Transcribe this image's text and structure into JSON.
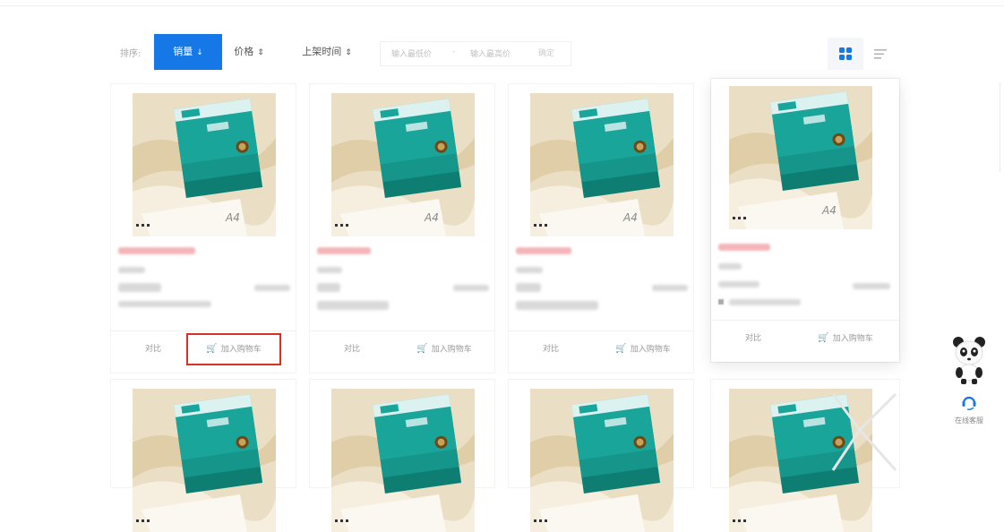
{
  "toolbar": {
    "sort_label": "排序:",
    "sort_options": [
      {
        "label": "销量",
        "arrow": "↓",
        "active": true
      },
      {
        "label": "价格",
        "arrow": "⇕",
        "active": false
      },
      {
        "label": "上架时间",
        "arrow": "⇕",
        "active": false
      }
    ],
    "price_min_placeholder": "输入最低价",
    "price_separator": "-",
    "price_max_placeholder": "输入最高价",
    "price_confirm": "确定",
    "view_grid_icon": "grid-view-icon",
    "view_list_icon": "list-view-icon"
  },
  "products": [
    {
      "compare_label": "对比",
      "cart_label": "加入购物车"
    },
    {
      "compare_label": "对比",
      "cart_label": "加入购物车"
    },
    {
      "compare_label": "对比",
      "cart_label": "加入购物车"
    },
    {
      "compare_label": "对比",
      "cart_label": "加入购物车"
    }
  ],
  "product_image_text": "A4",
  "service": {
    "label": "在线客服",
    "icon": "panda-mascot-icon"
  },
  "colors": {
    "accent": "#1677e6",
    "highlight_border": "#d93025",
    "cart_icon": "#f5a623",
    "box_teal": "#1aa59a"
  }
}
